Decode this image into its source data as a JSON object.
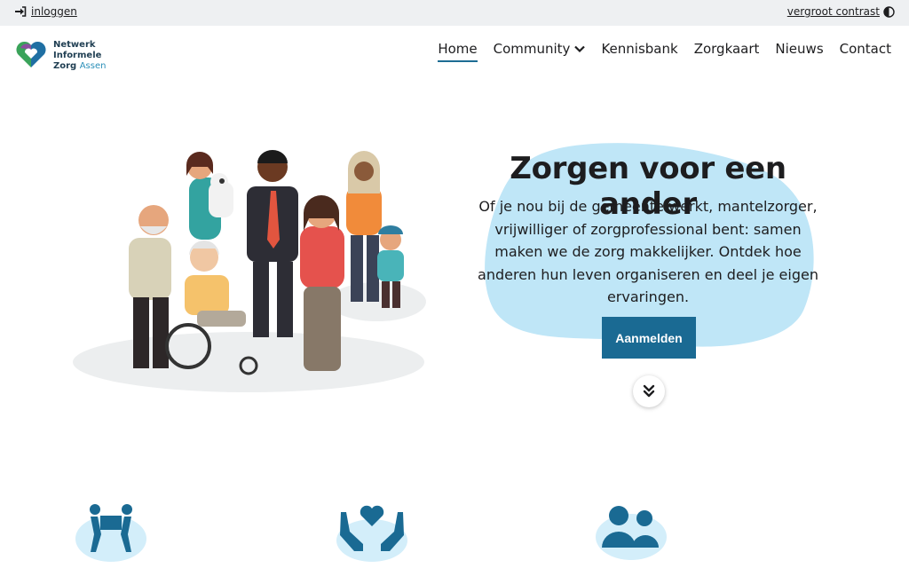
{
  "topbar": {
    "login_label": "inloggen",
    "login_icon": "sign-in-icon",
    "contrast_label": "vergroot contrast",
    "contrast_icon": "half-circle-icon"
  },
  "logo": {
    "line1": "Netwerk",
    "line2": "Informele",
    "line3a": "Zorg",
    "line3b": "Assen",
    "icon": "heart-logo-icon"
  },
  "nav": {
    "items": [
      {
        "label": "Home"
      },
      {
        "label": "Community"
      },
      {
        "label": "Kennisbank"
      },
      {
        "label": "Zorgkaart"
      },
      {
        "label": "Nieuws"
      },
      {
        "label": "Contact"
      }
    ]
  },
  "hero": {
    "title": "Zorgen voor een ander",
    "text": "Of je nou bij de gemeente werkt, mantelzorger, vrijwilliger of zorgprofessional bent: samen maken we de zorg makkelijker. Ontdek hoe anderen hun leven organiseren en deel je eigen ervaringen.",
    "cta_label": "Aanmelden",
    "scroll_icon": "double-chevron-down-icon"
  },
  "features": {
    "icons": [
      "people-carrying-box-icon",
      "hands-holding-heart-icon",
      "users-icon"
    ]
  },
  "colors": {
    "accent": "#1a6a93",
    "blob": "#bfe6f7",
    "topbar": "#eef0f2"
  }
}
